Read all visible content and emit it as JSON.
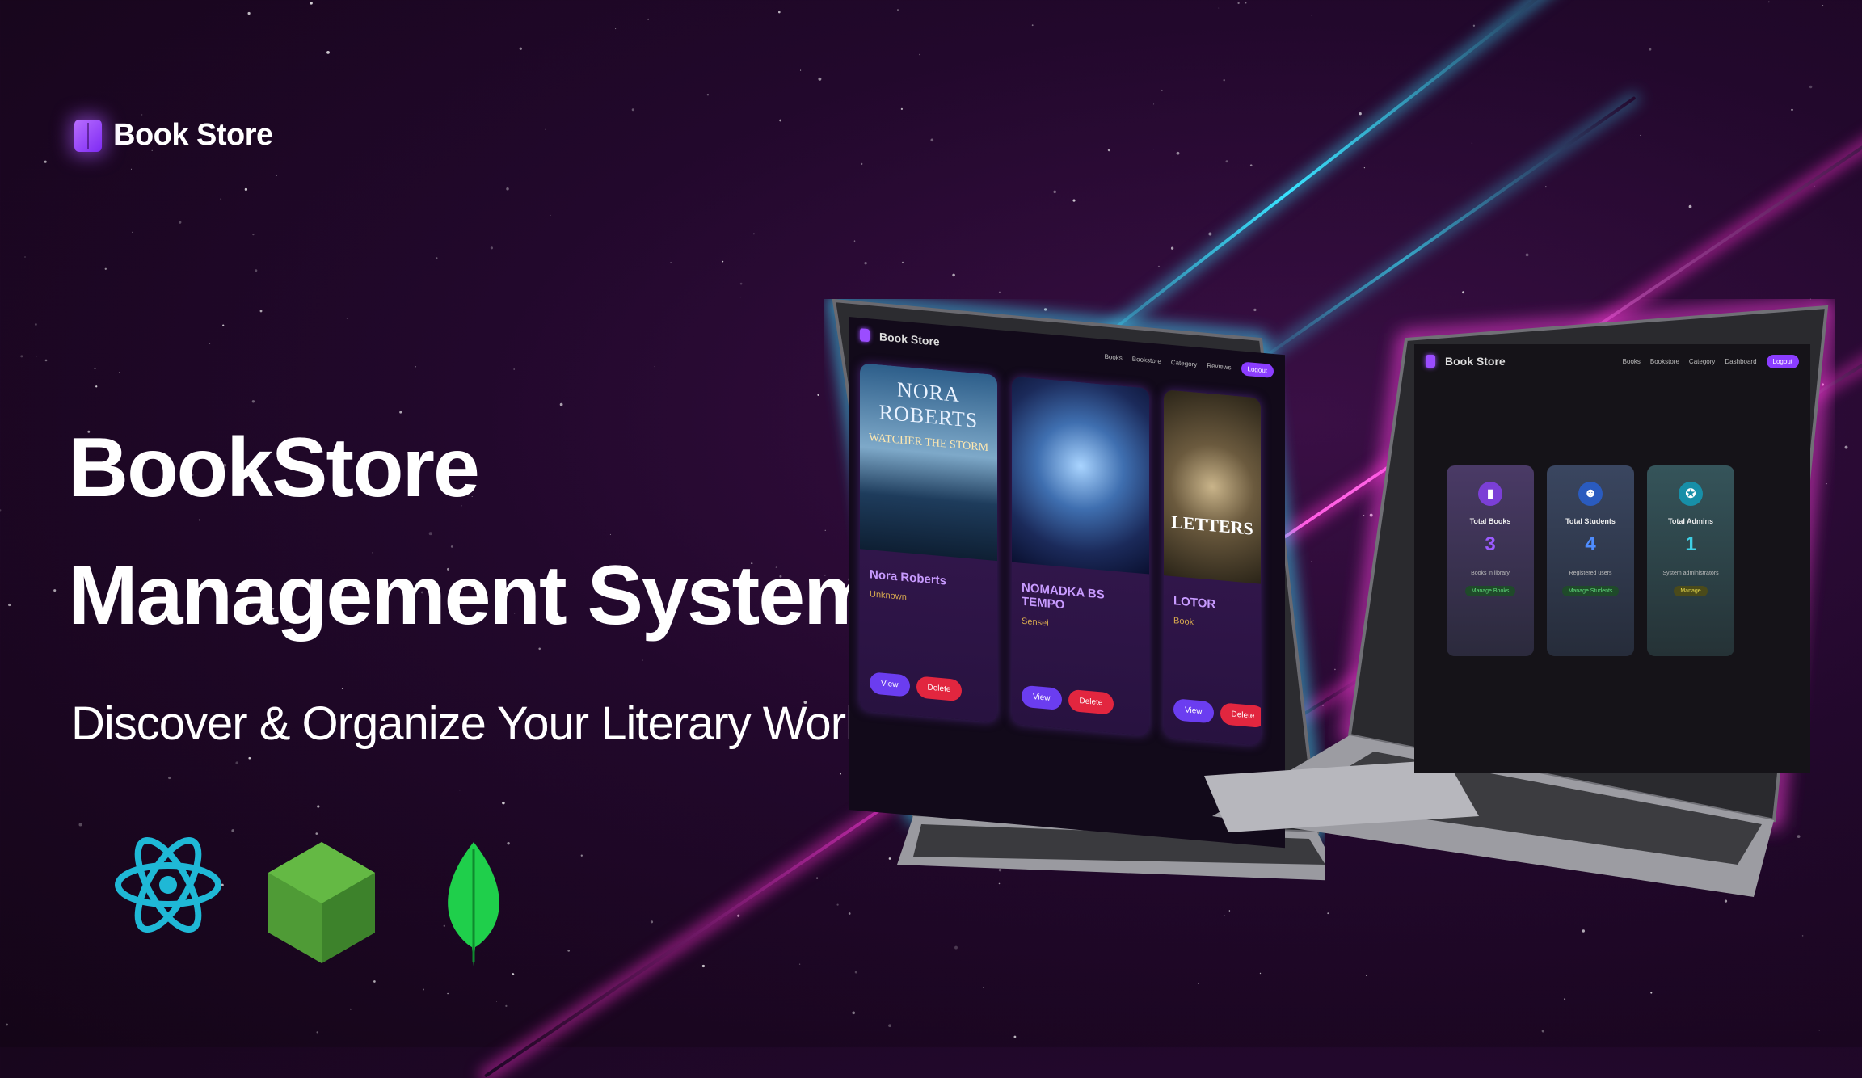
{
  "brand": {
    "name": "Book Store"
  },
  "hero": {
    "title_line1": "BookStore",
    "title_line2": "Management System",
    "subtitle": "Discover & Organize Your Literary World"
  },
  "tech_icons": [
    "react-icon",
    "nodejs-icon",
    "mongodb-icon"
  ],
  "colors": {
    "accent": "#8b3dff",
    "magenta_beam": "#ff37d9",
    "cyan_beam": "#39e3ff",
    "background": "#22082c"
  },
  "laptop_left": {
    "nav": {
      "title": "Book Store",
      "items": [
        "Books",
        "Bookstore",
        "Category",
        "Reviews"
      ],
      "button": "Logout"
    },
    "books": [
      {
        "cover_title": "NORA ROBERTS",
        "cover_subtitle": "WATCHER THE STORM",
        "title": "Nora Roberts",
        "author": "Unknown",
        "view": "View",
        "delete": "Delete"
      },
      {
        "cover_title": "",
        "cover_subtitle": "",
        "title": "NOMADKA BS TEMPO",
        "author": "Sensei",
        "view": "View",
        "delete": "Delete"
      },
      {
        "cover_title": "LETTERS",
        "cover_subtitle": "",
        "title": "LOTOR",
        "author": "Book",
        "view": "View",
        "delete": "Delete"
      }
    ]
  },
  "laptop_right": {
    "nav": {
      "title": "Book Store",
      "items": [
        "Books",
        "Bookstore",
        "Category",
        "Dashboard"
      ],
      "button": "Logout"
    },
    "stats": [
      {
        "label": "Total Books",
        "value": "3",
        "note": "Books in library",
        "badge": "Manage Books",
        "color": "#7b3fd6"
      },
      {
        "label": "Total Students",
        "value": "4",
        "note": "Registered users",
        "badge": "Manage Students",
        "color": "#2a5bbf"
      },
      {
        "label": "Total Admins",
        "value": "1",
        "note": "System administrators",
        "badge": "Manage",
        "color": "#178fa8"
      }
    ]
  }
}
